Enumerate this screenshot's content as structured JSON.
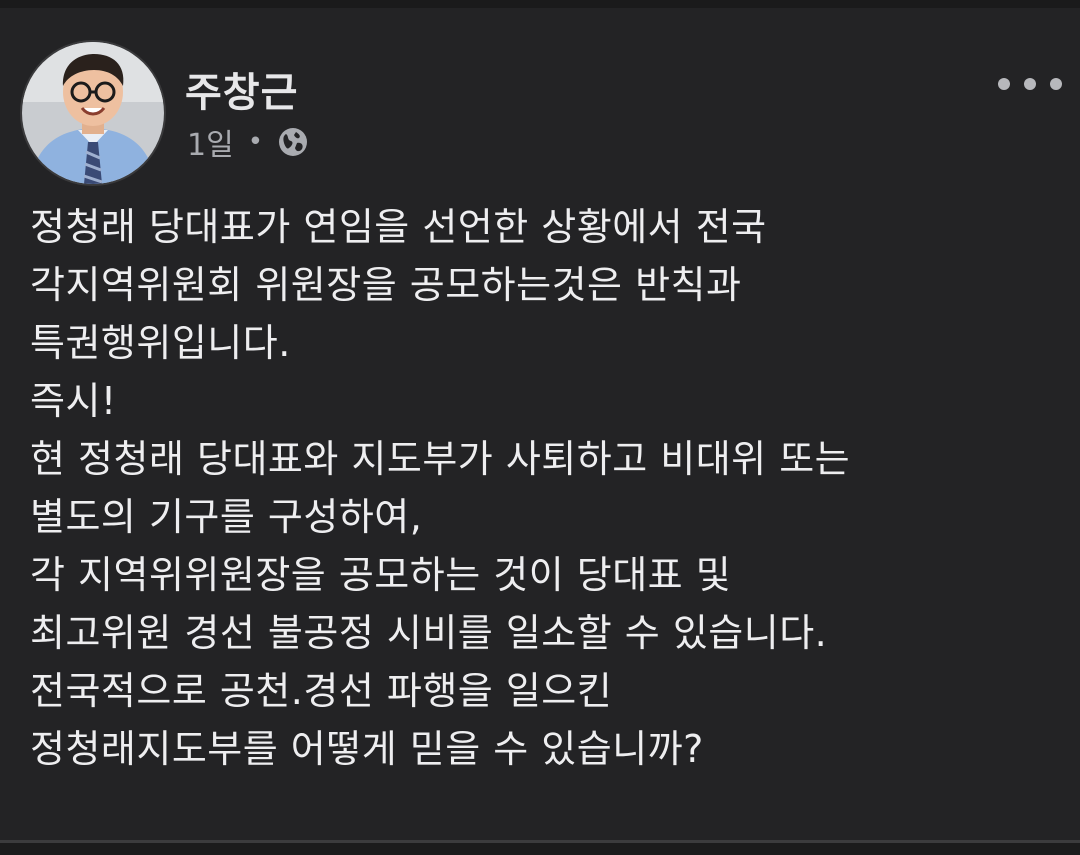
{
  "post": {
    "author": "주창근",
    "time": "1일",
    "separator": "•",
    "privacy_icon": "globe-icon",
    "more_icon": "more-options-icon",
    "lines": [
      "정청래 당대표가 연임을 선언한 상황에서 전국",
      "각지역위원회 위원장을 공모하는것은 반칙과",
      "특권행위입니다.",
      "즉시!",
      "현 정청래 당대표와 지도부가 사퇴하고 비대위 또는",
      "별도의 기구를 구성하여,",
      "각 지역위위원장을 공모하는 것이 당대표 및",
      "최고위원 경선 불공정 시비를 일소할 수 있습니다.",
      "전국적으로 공천.경선 파행을 일으킨",
      "정청래지도부를 어떻게 믿을 수 있습니까?"
    ]
  },
  "colors": {
    "background": "#232325",
    "text": "#eeeef0",
    "muted": "#a9abb0"
  }
}
